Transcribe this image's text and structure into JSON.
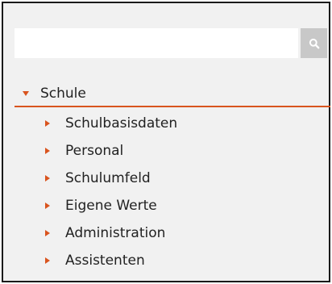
{
  "search": {
    "value": "",
    "placeholder": ""
  },
  "tree": {
    "root": {
      "label": "Schule",
      "expanded": true
    },
    "children": [
      {
        "label": "Schulbasisdaten"
      },
      {
        "label": "Personal"
      },
      {
        "label": "Schulumfeld"
      },
      {
        "label": "Eigene Werte"
      },
      {
        "label": "Administration"
      },
      {
        "label": "Assistenten"
      }
    ]
  },
  "colors": {
    "accent": "#d9541e",
    "panel_bg": "#f1f1f1",
    "search_button_bg": "#c8c8c8"
  },
  "icons": {
    "search": "search-icon",
    "expanded": "caret-down-icon",
    "collapsed": "caret-right-icon"
  }
}
